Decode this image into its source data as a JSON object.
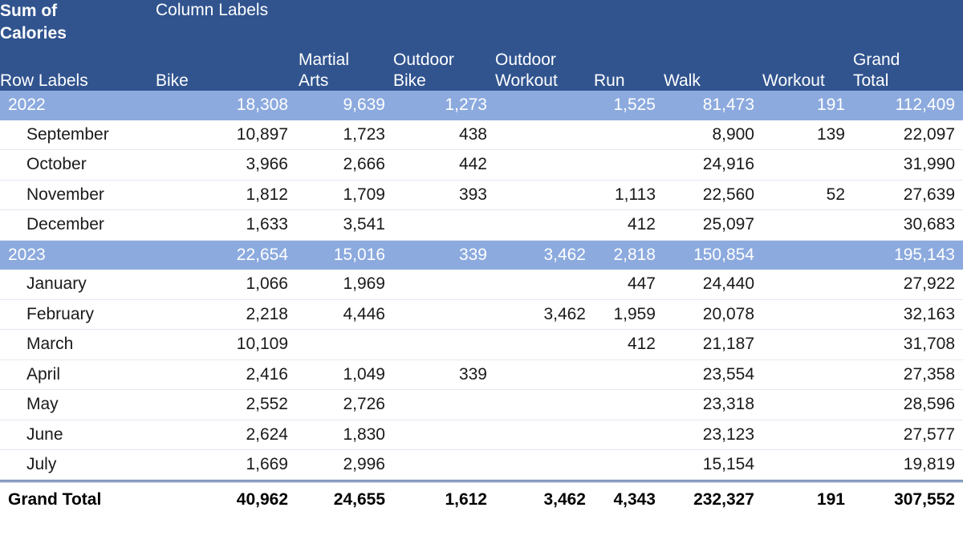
{
  "header": {
    "value_field": "Sum of\nCalories",
    "column_labels": "Column Labels",
    "row_labels": "Row Labels",
    "columns": [
      "Bike",
      "Martial\nArts",
      "Outdoor\nBike",
      "Outdoor\nWorkout",
      "Run",
      "Walk",
      "Workout",
      "Grand\nTotal"
    ]
  },
  "colors": {
    "header_bg": "#31548F",
    "subtotal_bg": "#8CAADE",
    "header_text": "#FFFFFF",
    "body_text": "#1A1A1A",
    "row_divider": "#E3E8F0",
    "total_rule": "#31548F"
  },
  "chart_data": {
    "type": "table",
    "title": "Sum of Calories",
    "row_label_header": "Row Labels",
    "column_label_header": "Column Labels",
    "categories": [
      "Bike",
      "Martial Arts",
      "Outdoor Bike",
      "Outdoor Workout",
      "Run",
      "Walk",
      "Workout",
      "Grand Total"
    ],
    "rows": [
      {
        "label": "2022",
        "type": "subtotal",
        "values": [
          "18,308",
          "9,639",
          "1,273",
          "",
          "1,525",
          "81,473",
          "191",
          "112,409"
        ]
      },
      {
        "label": "September",
        "type": "detail",
        "values": [
          "10,897",
          "1,723",
          "438",
          "",
          "",
          "8,900",
          "139",
          "22,097"
        ]
      },
      {
        "label": "October",
        "type": "detail",
        "values": [
          "3,966",
          "2,666",
          "442",
          "",
          "",
          "24,916",
          "",
          "31,990"
        ]
      },
      {
        "label": "November",
        "type": "detail",
        "values": [
          "1,812",
          "1,709",
          "393",
          "",
          "1,113",
          "22,560",
          "52",
          "27,639"
        ]
      },
      {
        "label": "December",
        "type": "detail",
        "values": [
          "1,633",
          "3,541",
          "",
          "",
          "412",
          "25,097",
          "",
          "30,683"
        ]
      },
      {
        "label": "2023",
        "type": "subtotal",
        "values": [
          "22,654",
          "15,016",
          "339",
          "3,462",
          "2,818",
          "150,854",
          "",
          "195,143"
        ]
      },
      {
        "label": "January",
        "type": "detail",
        "values": [
          "1,066",
          "1,969",
          "",
          "",
          "447",
          "24,440",
          "",
          "27,922"
        ]
      },
      {
        "label": "February",
        "type": "detail",
        "values": [
          "2,218",
          "4,446",
          "",
          "3,462",
          "1,959",
          "20,078",
          "",
          "32,163"
        ]
      },
      {
        "label": "March",
        "type": "detail",
        "values": [
          "10,109",
          "",
          "",
          "",
          "412",
          "21,187",
          "",
          "31,708"
        ]
      },
      {
        "label": "April",
        "type": "detail",
        "values": [
          "2,416",
          "1,049",
          "339",
          "",
          "",
          "23,554",
          "",
          "27,358"
        ]
      },
      {
        "label": "May",
        "type": "detail",
        "values": [
          "2,552",
          "2,726",
          "",
          "",
          "",
          "23,318",
          "",
          "28,596"
        ]
      },
      {
        "label": "June",
        "type": "detail",
        "values": [
          "2,624",
          "1,830",
          "",
          "",
          "",
          "23,123",
          "",
          "27,577"
        ]
      },
      {
        "label": "July",
        "type": "detail",
        "values": [
          "1,669",
          "2,996",
          "",
          "",
          "",
          "15,154",
          "",
          "19,819"
        ]
      },
      {
        "label": "Grand Total",
        "type": "grand",
        "values": [
          "40,962",
          "24,655",
          "1,612",
          "3,462",
          "4,343",
          "232,327",
          "191",
          "307,552"
        ]
      }
    ]
  }
}
